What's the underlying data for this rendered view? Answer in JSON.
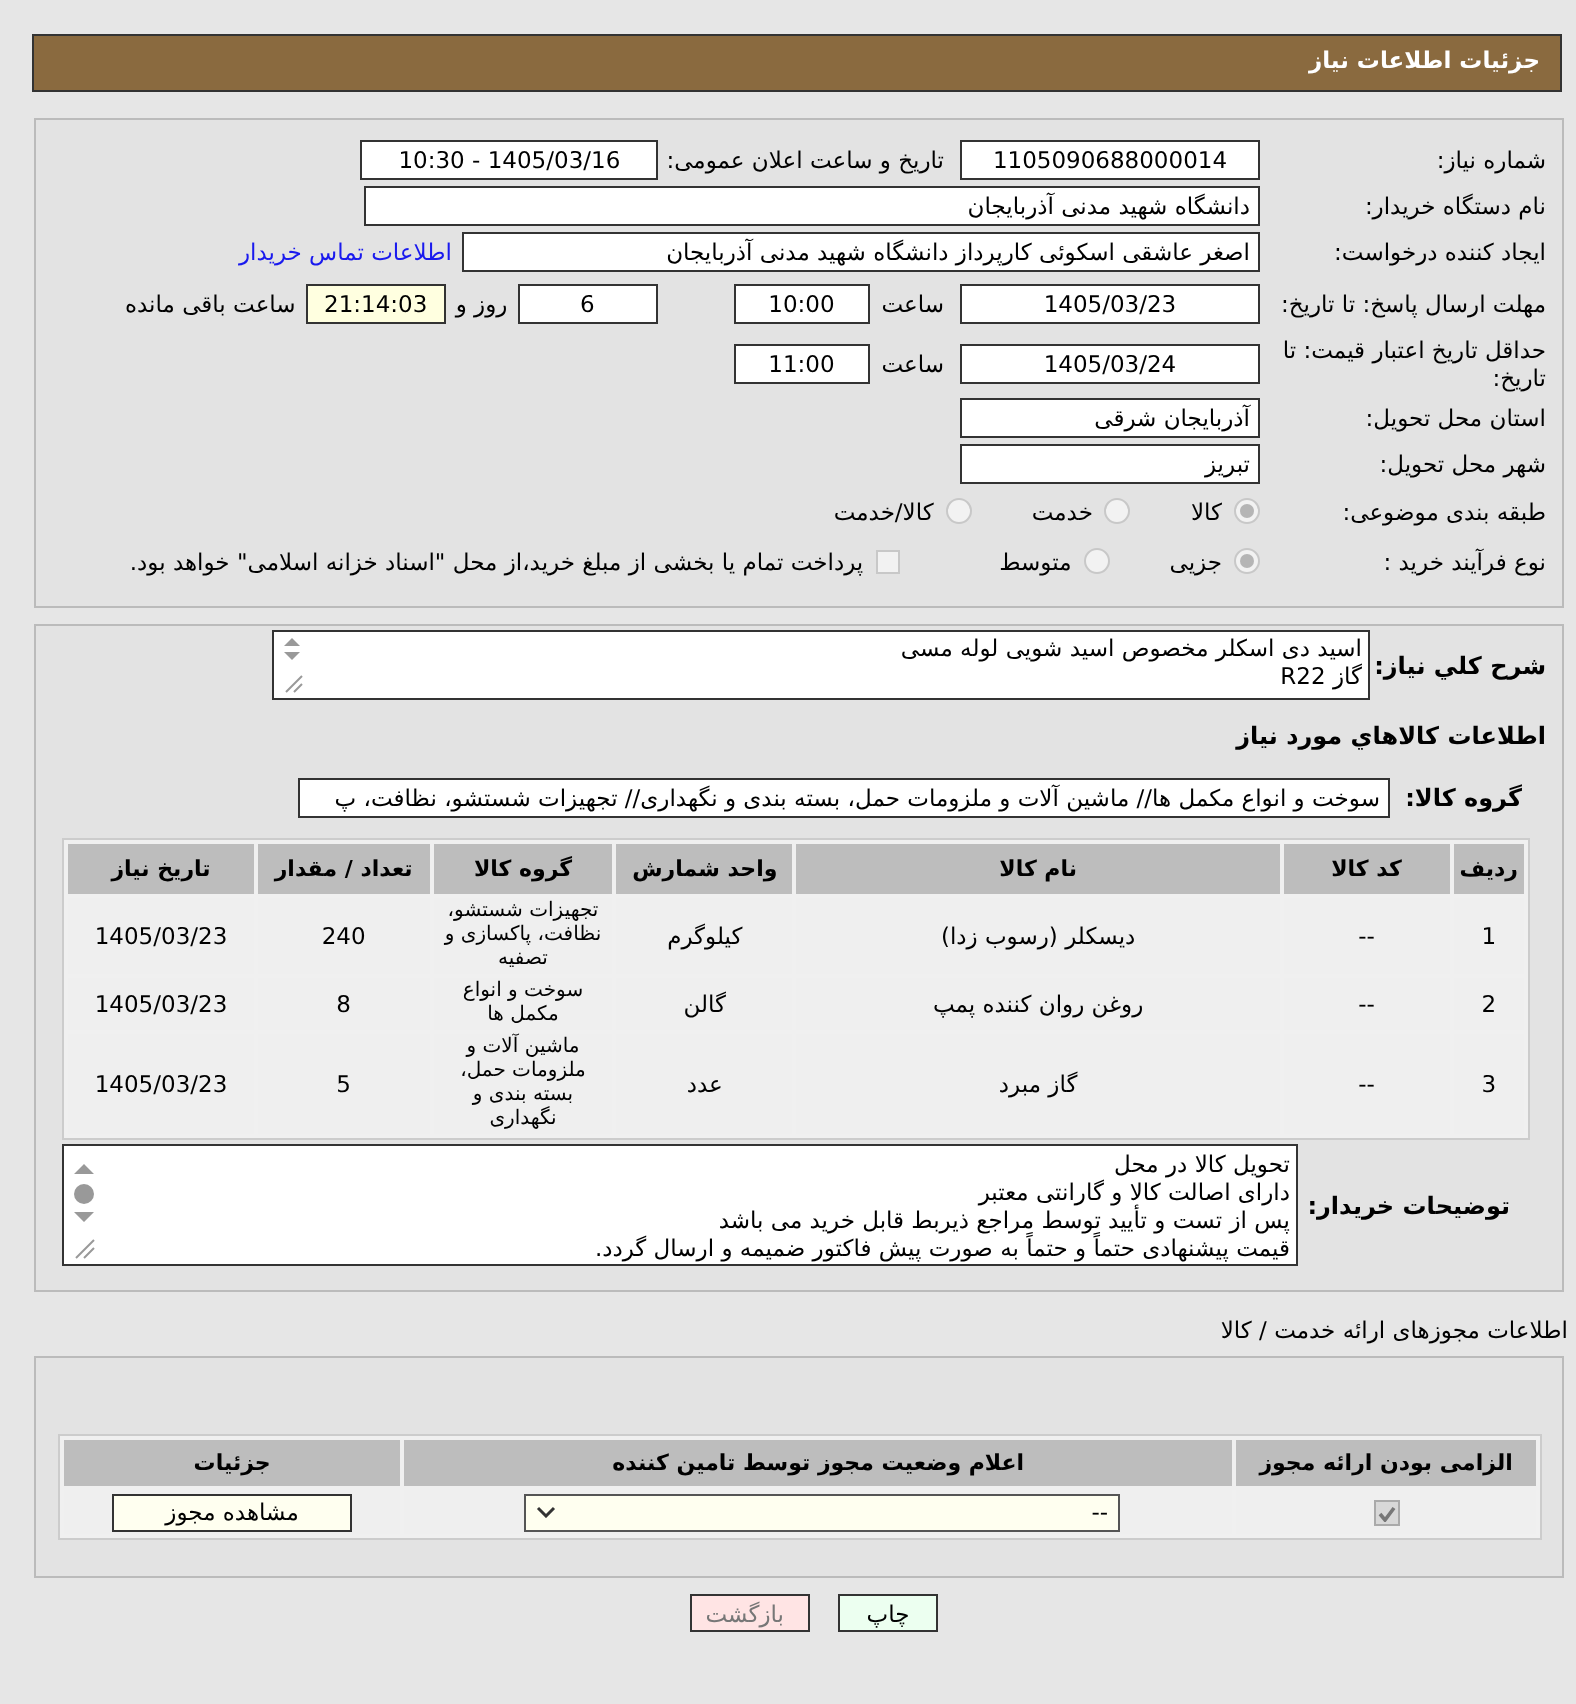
{
  "header": {
    "title": "جزئیات اطلاعات نیاز"
  },
  "need": {
    "rows": [
      {
        "kind": "pair",
        "label": "شماره نیاز:",
        "value": "1105090688000014",
        "label2": "تاریخ و ساعت اعلان عمومی:",
        "value2": "1405/03/16 - 10:30"
      },
      {
        "kind": "wide",
        "label": "نام دستگاه خریدار:",
        "value": "دانشگاه شهید مدنی آذربایجان"
      },
      {
        "kind": "link",
        "label": "ایجاد کننده درخواست:",
        "value": "اصغر عاشقی اسکوئی کارپرداز دانشگاه شهید مدنی آذربایجان",
        "link": "اطلاعات تماس خریدار"
      },
      {
        "kind": "deadline",
        "label": "مهلت ارسال پاسخ: تا تاریخ:",
        "date": "1405/03/23",
        "time_label": "ساعت",
        "time": "10:00",
        "days": "6",
        "days_label": "روز و",
        "remaining": "21:14:03",
        "remaining_label": "ساعت باقی مانده"
      },
      {
        "kind": "datetime",
        "label": "حداقل تاریخ اعتبار قیمت: تا تاریخ:",
        "date": "1405/03/24",
        "time_label": "ساعت",
        "time": "11:00"
      },
      {
        "kind": "single",
        "label": "استان محل تحویل:",
        "value": "آذربایجان شرقی"
      },
      {
        "kind": "single",
        "label": "شهر محل تحویل:",
        "value": "تبریز"
      },
      {
        "kind": "radios",
        "label": "طبقه بندی موضوعی:",
        "options": [
          {
            "label": "کالا",
            "selected": true
          },
          {
            "label": "خدمت",
            "selected": false
          },
          {
            "label": "کالا/خدمت",
            "selected": false
          }
        ]
      },
      {
        "kind": "radios",
        "label": "نوع فرآیند خرید :",
        "options": [
          {
            "label": "جزیی",
            "selected": true
          },
          {
            "label": "متوسط",
            "selected": false
          }
        ],
        "checkbox": {
          "label": "پرداخت تمام یا بخشی از مبلغ خرید،از محل \"اسناد خزانه اسلامی\" خواهد بود.",
          "checked": false
        }
      }
    ]
  },
  "description": {
    "label": "شرح كلي نياز:",
    "lines": [
      "اسید دی اسکلر مخصوص اسید شویی لوله مسی",
      "گاز R22"
    ]
  },
  "items": {
    "title": "اطلاعات كالاهاي مورد نياز",
    "group_label": "گروه کالا:",
    "group_value": "سوخت و انواع مکمل ها// ماشین آلات و ملزومات حمل، بسته بندی و نگهداری// تجهیزات شستشو، نظافت، پ",
    "columns": [
      "ردیف",
      "کد کالا",
      "نام کالا",
      "واحد شمارش",
      "گروه کالا",
      "تعداد / مقدار",
      "تاریخ نیاز"
    ],
    "rows": [
      [
        "1",
        "--",
        "دیسکلر (رسوب زدا)",
        "کیلوگرم",
        "تجهیزات شستشو، نظافت، پاکسازی و تصفیه",
        "240",
        "1405/03/23"
      ],
      [
        "2",
        "--",
        "روغن روان کننده پمپ",
        "گالن",
        "سوخت و انواع مکمل ها",
        "8",
        "1405/03/23"
      ],
      [
        "3",
        "--",
        "گاز مبرد",
        "عدد",
        "ماشین آلات و ملزومات حمل، بسته بندی و نگهداری",
        "5",
        "1405/03/23"
      ]
    ]
  },
  "notes": {
    "label": "توضیحات خریدار:",
    "lines": [
      "تحویل کالا در محل",
      "دارای اصالت کالا و گارانتی معتبر",
      "پس از تست و تأیید توسط مراجع ذیربط قابل خرید می باشد",
      "قیمت پیشنهادی حتماً و حتماً به صورت پیش فاکتور ضمیمه و ارسال گردد."
    ]
  },
  "permits": {
    "title": "اطلاعات مجوزهای ارائه خدمت / کالا",
    "columns": [
      "الزامی بودن ارائه مجوز",
      "اعلام وضعیت مجوز توسط تامین کننده",
      "جزئیات"
    ],
    "rows": [
      {
        "required": true,
        "status": "--",
        "details": "مشاهده مجوز"
      }
    ]
  },
  "actions": [
    {
      "kind": "print",
      "label": "چاپ"
    },
    {
      "kind": "back",
      "label": "بازگشت"
    }
  ]
}
